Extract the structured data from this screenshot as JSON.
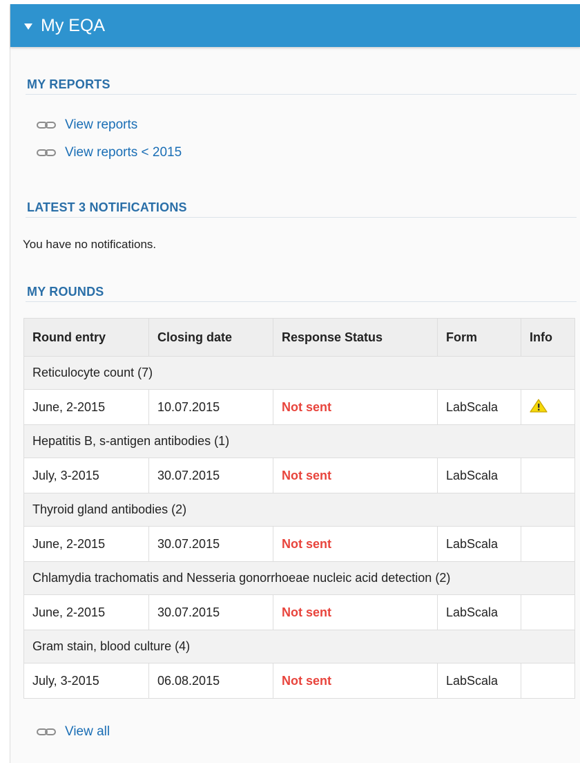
{
  "panel": {
    "title": "My EQA"
  },
  "my_reports": {
    "title": "MY REPORTS",
    "links": [
      "View reports",
      "View reports < 2015"
    ]
  },
  "notifications": {
    "title": "LATEST 3 NOTIFICATIONS",
    "empty_text": "You have no notifications."
  },
  "my_rounds": {
    "title": "MY ROUNDS",
    "columns": [
      "Round entry",
      "Closing date",
      "Response Status",
      "Form",
      "Info"
    ],
    "groups": [
      {
        "name": "Reticulocyte count (7)",
        "entry": "June, 2-2015",
        "closing": "10.07.2015",
        "status": "Not sent",
        "form": "LabScala",
        "info_icon": "warning-icon"
      },
      {
        "name": "Hepatitis B, s-antigen antibodies (1)",
        "entry": "July, 3-2015",
        "closing": "30.07.2015",
        "status": "Not sent",
        "form": "LabScala",
        "info_icon": ""
      },
      {
        "name": "Thyroid gland antibodies (2)",
        "entry": "June, 2-2015",
        "closing": "30.07.2015",
        "status": "Not sent",
        "form": "LabScala",
        "info_icon": ""
      },
      {
        "name": "Chlamydia trachomatis and Nesseria gonorrhoeae nucleic acid detection (2)",
        "entry": "June, 2-2015",
        "closing": "30.07.2015",
        "status": "Not sent",
        "form": "LabScala",
        "info_icon": ""
      },
      {
        "name": "Gram stain, blood culture (4)",
        "entry": "July, 3-2015",
        "closing": "06.08.2015",
        "status": "Not sent",
        "form": "LabScala",
        "info_icon": ""
      }
    ],
    "view_all": "View all"
  },
  "colors": {
    "header_bg": "#2e93cf",
    "section_title": "#2a6fa8",
    "link": "#1a6eb5",
    "status_not_sent": "#e8443c",
    "warning_fill": "#f5d90a"
  }
}
